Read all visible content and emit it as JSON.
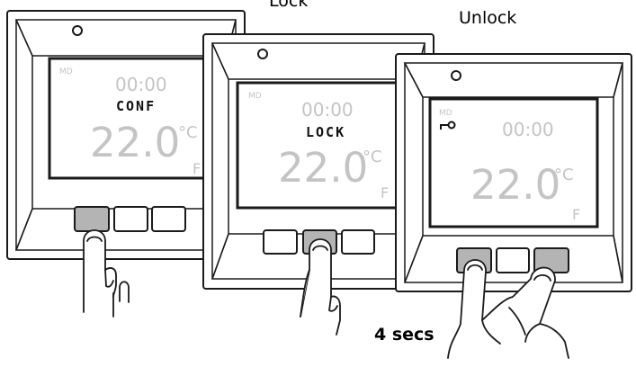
{
  "headers": {
    "lock": "Lock",
    "unlock": "Unlock"
  },
  "units": {
    "celsius": "°C",
    "fahrenheit": "F"
  },
  "panels": [
    {
      "mode": "MD",
      "time": "00:00",
      "status": "CONF",
      "temperature": "22.0"
    },
    {
      "mode": "MD",
      "time": "00:00",
      "status": "LOCK",
      "temperature": "22.0"
    },
    {
      "mode": "MD",
      "time": "00:00",
      "status": "",
      "temperature": "22.0"
    }
  ],
  "duration_label": "4 secs",
  "icons": [
    "key-icon",
    "finger-press-icon",
    "two-finger-press-icon"
  ],
  "colors": {
    "outline": "#1a1a1a",
    "pressed_button": "#b4b4b4",
    "lcd_dim": "#c9c9c9"
  }
}
